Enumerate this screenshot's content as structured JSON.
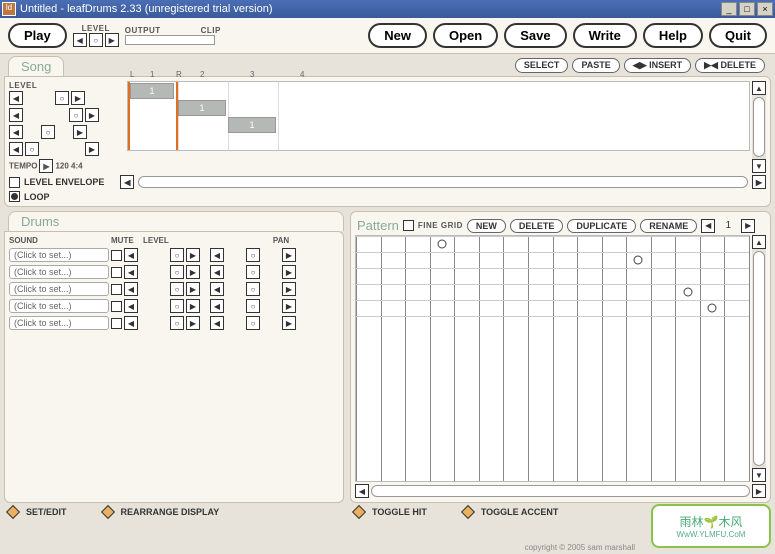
{
  "window": {
    "title": "Untitled - leafDrums 2.33 (unregistered trial version)"
  },
  "toolbar": {
    "play": "Play",
    "level": "LEVEL",
    "output": "OUTPUT",
    "clip": "CLIP",
    "new": "New",
    "open": "Open",
    "save": "Save",
    "write": "Write",
    "help": "Help",
    "quit": "Quit"
  },
  "song": {
    "title": "Song",
    "select": "SELECT",
    "paste": "PASTE",
    "insert": "INSERT",
    "delete": "DELETE",
    "level": "LEVEL",
    "tempo_lbl": "TEMPO",
    "tempo_val": "120 4:4",
    "markers": {
      "l": "L",
      "r": "R",
      "n1": "1",
      "n2": "2",
      "n3": "3",
      "n4": "4"
    },
    "cells": [
      "1",
      "1",
      "1"
    ],
    "level_envelope": "LEVEL ENVELOPE",
    "loop": "LOOP"
  },
  "drums": {
    "title": "Drums",
    "sound": "SOUND",
    "mute": "MUTE",
    "level": "LEVEL",
    "pan": "PAN",
    "rows": [
      "(Click to set...)",
      "(Click to set...)",
      "(Click to set...)",
      "(Click to set...)",
      "(Click to set...)"
    ],
    "set_edit": "SET/EDIT",
    "rearrange": "REARRANGE DISPLAY"
  },
  "pattern": {
    "title": "Pattern",
    "fine_grid": "FINE GRID",
    "new": "NEW",
    "delete": "DELETE",
    "duplicate": "DUPLICATE",
    "rename": "RENAME",
    "num": "1",
    "toggle_hit": "TOGGLE HIT",
    "toggle_accent": "TOGGLE ACCENT",
    "hits": [
      {
        "col": 3,
        "row": 0
      },
      {
        "col": 11,
        "row": 1
      },
      {
        "col": 13,
        "row": 3
      },
      {
        "col": 14,
        "row": 4
      }
    ]
  },
  "footer": {
    "copyright": "copyright © 2005 sam marshall"
  }
}
